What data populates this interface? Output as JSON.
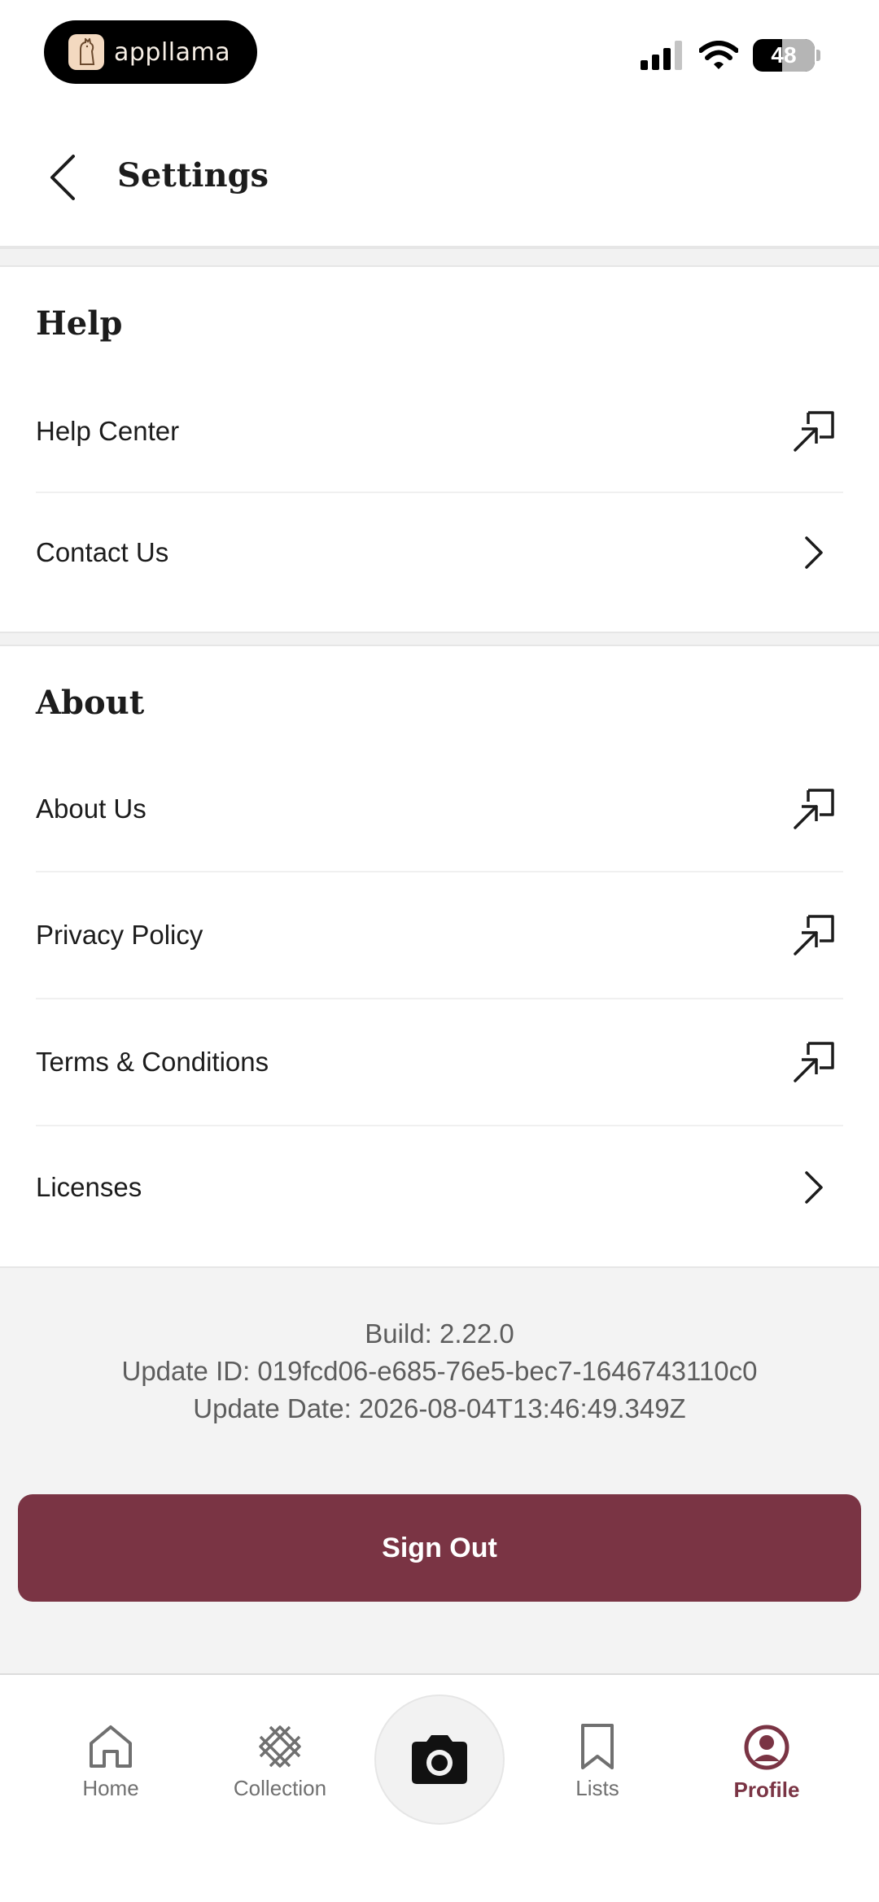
{
  "status_bar": {
    "app_name": "appllama",
    "battery": "48"
  },
  "header": {
    "title": "Settings"
  },
  "help": {
    "title": "Help",
    "items": [
      {
        "label": "Help Center",
        "icon": "external-link-icon"
      },
      {
        "label": "Contact Us",
        "icon": "chevron-right-icon"
      }
    ]
  },
  "about": {
    "title": "About",
    "items": [
      {
        "label": "About Us",
        "icon": "external-link-icon"
      },
      {
        "label": "Privacy Policy",
        "icon": "external-link-icon"
      },
      {
        "label": "Terms & Conditions",
        "icon": "external-link-icon"
      },
      {
        "label": "Licenses",
        "icon": "chevron-right-icon"
      }
    ]
  },
  "build_info": {
    "build": "Build: 2.22.0",
    "update_id": "Update ID: 019fcd06-e685-76e5-bec7-1646743110c0",
    "update_date": "Update Date: 2026-08-04T13:46:49.349Z"
  },
  "sign_out_label": "Sign Out",
  "nav": {
    "items": [
      {
        "label": "Home",
        "icon": "home-icon"
      },
      {
        "label": "Collection",
        "icon": "collection-icon"
      },
      {
        "label": "",
        "icon": "camera-icon"
      },
      {
        "label": "Lists",
        "icon": "bookmark-icon"
      },
      {
        "label": "Profile",
        "icon": "profile-icon"
      }
    ],
    "active": "Profile"
  },
  "colors": {
    "accent": "#7a3444",
    "background_muted": "#f3f3f3"
  }
}
